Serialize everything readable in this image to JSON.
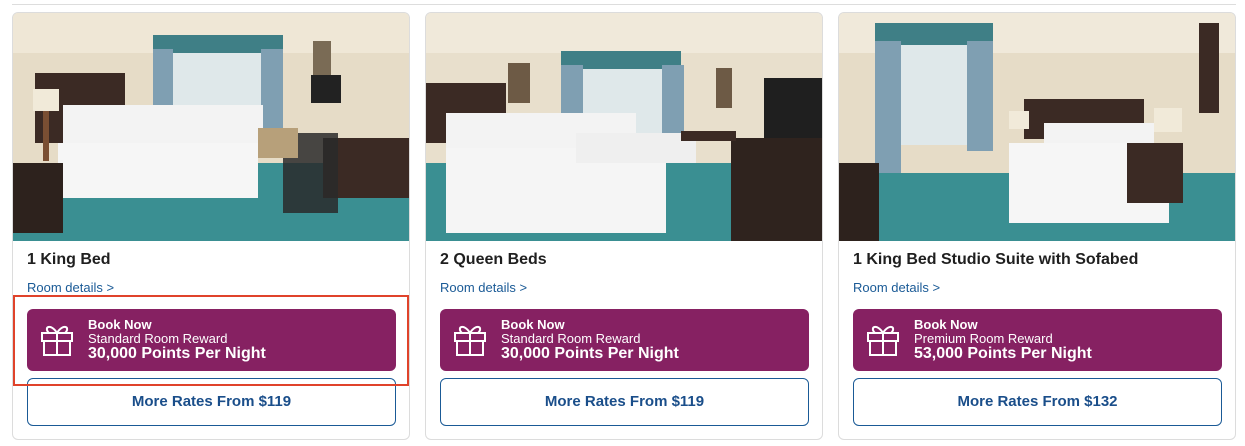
{
  "rooms": [
    {
      "title": "1 King Bed",
      "details_link": "Room details >",
      "book": {
        "label": "Book Now",
        "reward_type": "Standard Room Reward",
        "points": "30,000 Points Per Night"
      },
      "rates": "More Rates From $119",
      "image": "hotel-room-king-bed-desk-photo"
    },
    {
      "title": "2 Queen Beds",
      "details_link": "Room details >",
      "book": {
        "label": "Book Now",
        "reward_type": "Standard Room Reward",
        "points": "30,000 Points Per Night"
      },
      "rates": "More Rates From $119",
      "image": "hotel-room-two-queen-beds-photo"
    },
    {
      "title": "1 King Bed Studio Suite with Sofabed",
      "details_link": "Room details >",
      "book": {
        "label": "Book Now",
        "reward_type": "Premium Room Reward",
        "points": "53,000 Points Per Night"
      },
      "rates": "More Rates From $132",
      "image": "hotel-room-king-studio-suite-photo"
    }
  ],
  "icons": {
    "gift": "gift-icon"
  },
  "colors": {
    "book_button": "#862162",
    "link": "#1a5a96",
    "highlight": "#e0432b"
  }
}
